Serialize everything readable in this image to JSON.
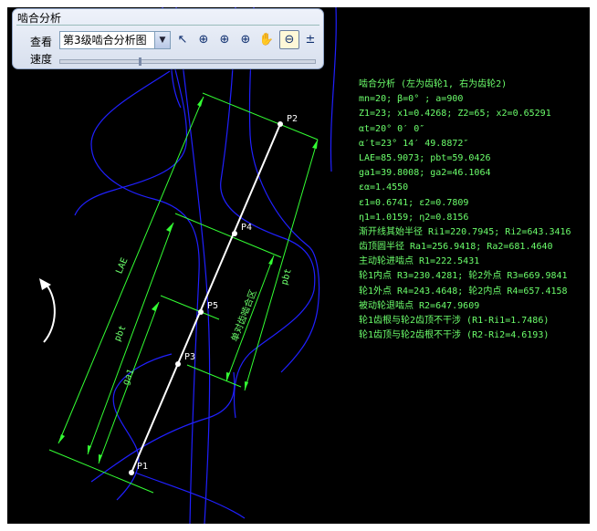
{
  "toolbar": {
    "title": "啮合分析",
    "view_label": "查看",
    "view_selected": "第3级啮合分析图",
    "speed_label": "速度",
    "speed_level": 0.31,
    "tools": [
      {
        "icon": "pointer-arrow-icon",
        "glyph": "↖"
      },
      {
        "icon": "zoom-fit-icon",
        "glyph": "⊕"
      },
      {
        "icon": "zoom-window-icon",
        "glyph": "⊕"
      },
      {
        "icon": "zoom-in-icon",
        "glyph": "⊕"
      },
      {
        "icon": "pan-hand-icon",
        "glyph": "✋"
      },
      {
        "icon": "zoom-out-icon",
        "glyph": "⊖"
      },
      {
        "icon": "zoom-realtime-icon",
        "glyph": "±"
      }
    ]
  },
  "info_lines": [
    "啮合分析 (左为齿轮1, 右为齿轮2)",
    "mn=20; β=0° ; a=900",
    "Z1=23; x1=0.4268; Z2=65; x2=0.65291",
    "αt=20° 0′ 0″",
    "α′t=23° 14′ 49.8872″",
    "LAE=85.9073; pbt=59.0426",
    "ga1=39.8008; ga2=46.1064",
    "εα=1.4550",
    "ε1=0.6741; ε2=0.7809",
    "η1=1.0159; η2=0.8156",
    "渐开线其始半径 Ri1=220.7945; Ri2=643.3416",
    "齿顶圆半径 Ra1=256.9418; Ra2=681.4640",
    "主动轮进啮点 R1=222.5431",
    "轮1内点 R3=230.4281; 轮2外点 R3=669.9841",
    "轮1外点 R4=243.4648; 轮2内点 R4=657.4158",
    "被动轮退啮点 R2=647.9609",
    "轮1齿根与轮2齿顶不干涉 (R1-Ri1=1.7486)",
    "轮1齿顶与轮2齿根不干涉 (R2-Ri2=4.6193)"
  ],
  "points": {
    "p1": "P1",
    "p2": "P2",
    "p3": "P3",
    "p4": "P4",
    "p5": "P5"
  },
  "dimensions": {
    "lae": "LAE",
    "pbt_left": "pbt",
    "ga1": "ga1",
    "pbt_right": "pbt",
    "single_mesh": "单对齿啮合区"
  },
  "colors": {
    "line_of_action": "#ffffff",
    "dimension": "#33ff33",
    "tooth_profile": "#2020ff",
    "background": "#000000",
    "info_text": "#6cff6c"
  }
}
